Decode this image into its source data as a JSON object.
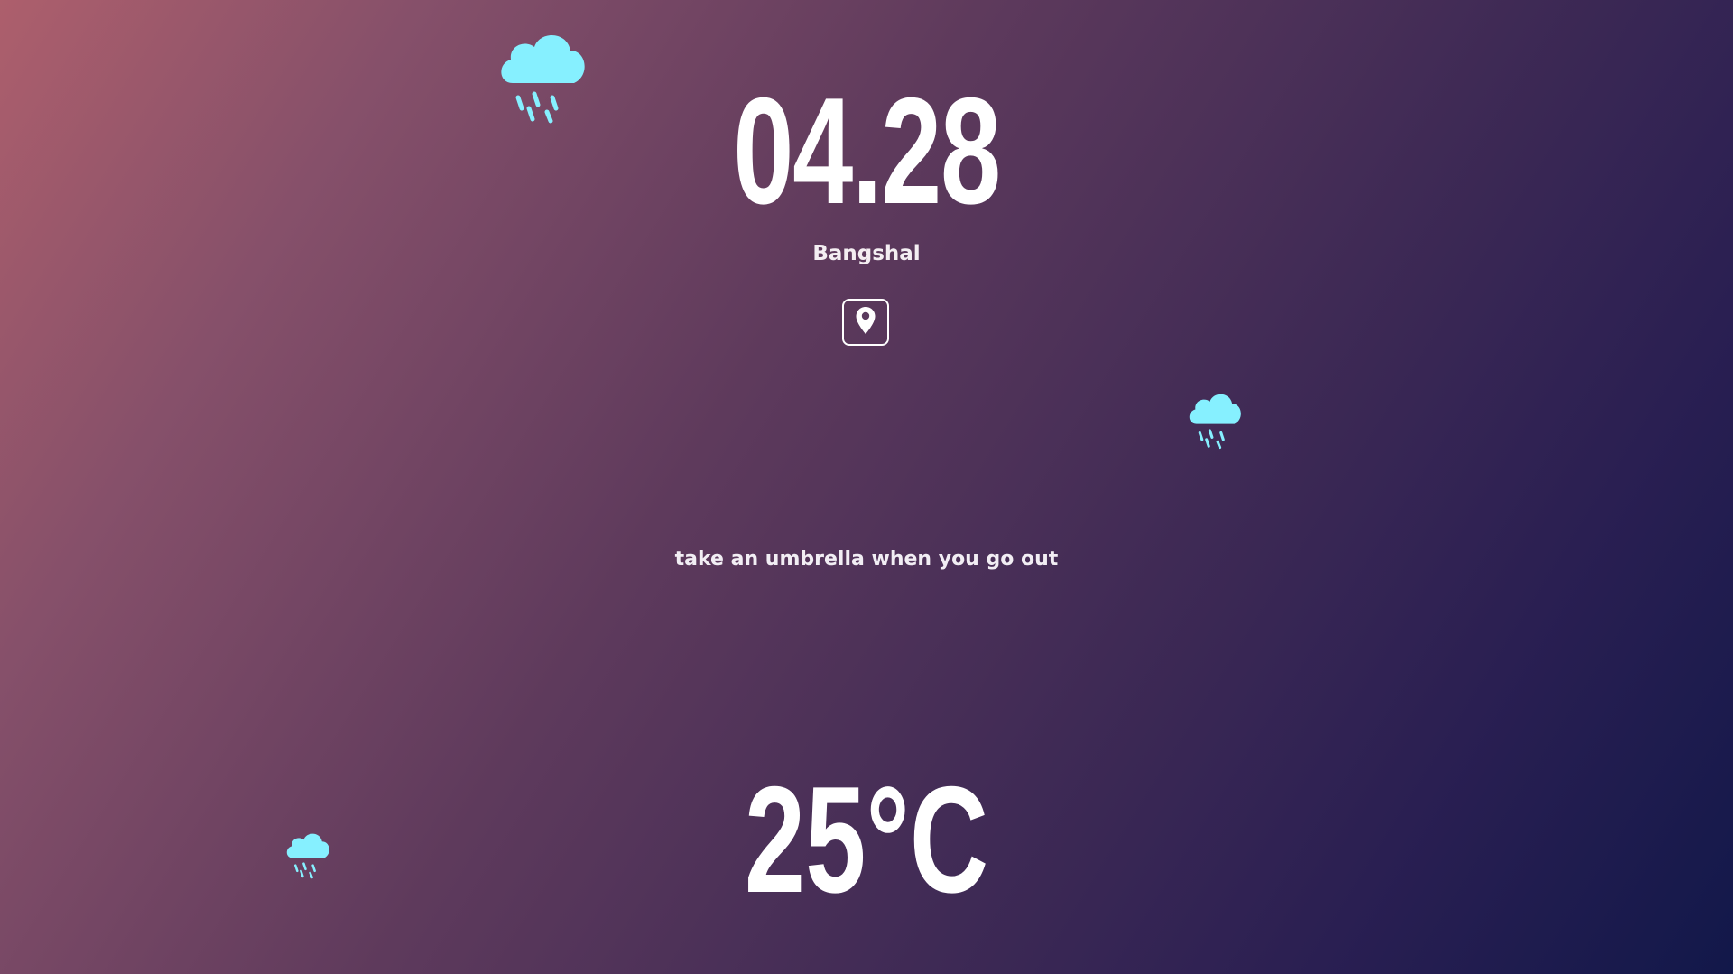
{
  "widget": {
    "date": "04.28",
    "location": "Bangshal",
    "message": "take an umbrella when you go out",
    "temperature": "25°C"
  },
  "icons": {
    "location_button": "map-pin-icon",
    "weather": "rain-cloud-icon"
  },
  "colors": {
    "background_start": "#ad5f6c",
    "background_end": "#12184a",
    "cloud": "#86f0ff",
    "text": "#ffffff"
  }
}
